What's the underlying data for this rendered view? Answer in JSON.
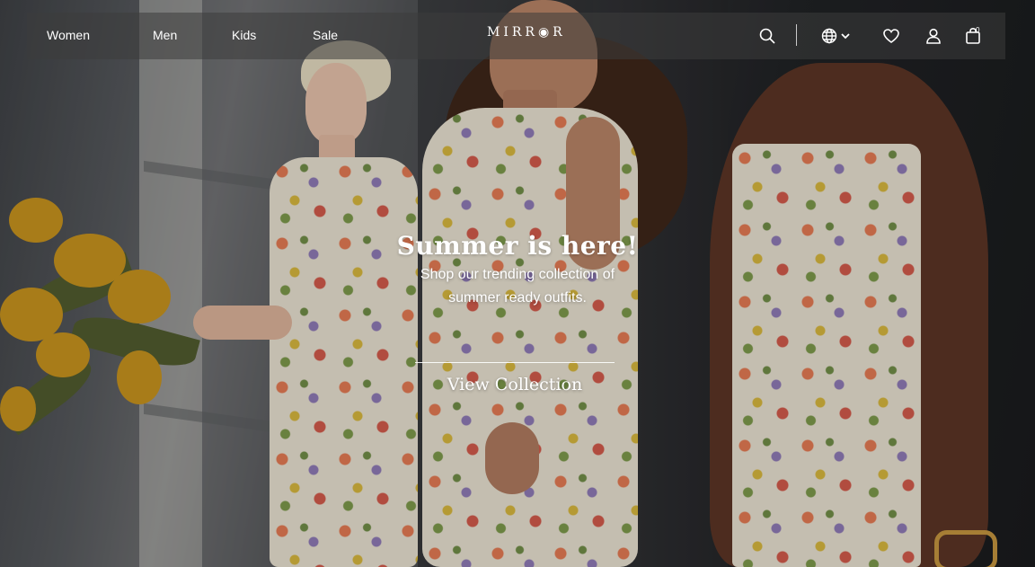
{
  "nav": {
    "links": [
      "Women",
      "Men",
      "Kids",
      "Sale"
    ],
    "logo": "MIRR◉R",
    "icons": [
      "search-icon",
      "globe-icon",
      "chevron-down-icon",
      "heart-icon",
      "user-icon",
      "shopping-bag-icon"
    ],
    "cart_count": "0"
  },
  "hero": {
    "title": "Summer is here!",
    "subtitle_line1": "Shop our trending collection of",
    "subtitle_line2": "summer ready outfits.",
    "cta": "View Collection"
  },
  "colors": {
    "text": "#ffffff",
    "nav_bg": "rgba(60,60,60,0.55)",
    "dress": "#ebe5d4",
    "mimosa": "#c9941c"
  }
}
